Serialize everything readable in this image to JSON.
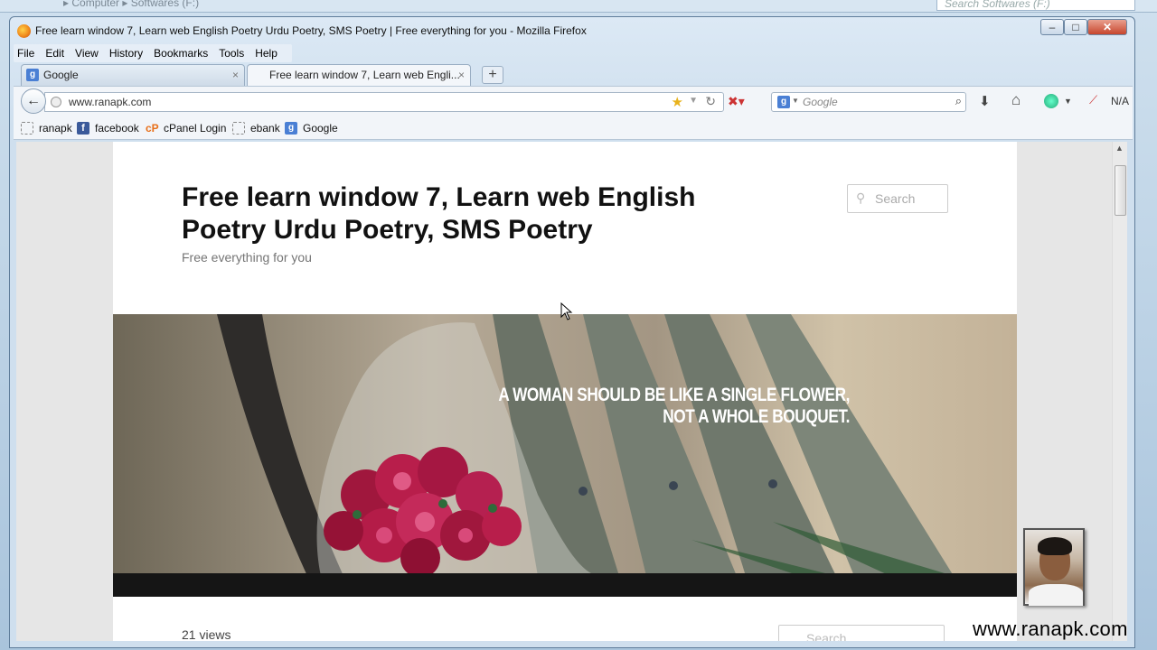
{
  "explorer": {
    "crumbs": "▸ Computer ▸ Softwares (F:)",
    "search_placeholder": "Search Softwares (F:)"
  },
  "window": {
    "title": "Free learn window 7, Learn web English Poetry Urdu Poetry, SMS Poetry | Free everything for you - Mozilla Firefox",
    "minimize": "–",
    "maximize": "□",
    "close": "✕"
  },
  "menubar": [
    "File",
    "Edit",
    "View",
    "History",
    "Bookmarks",
    "Tools",
    "Help"
  ],
  "tabs": [
    {
      "label": "Google",
      "close": "×"
    },
    {
      "label": "Free learn window 7, Learn web Engli...",
      "close": "×"
    }
  ],
  "newtab": "+",
  "nav": {
    "back": "←",
    "url": "www.ranapk.com",
    "star": "★",
    "dropdown": "▼",
    "reload": "↻",
    "search_engine": "Google",
    "search_go": "⌕",
    "download": "⬇",
    "home": "⌂",
    "addon_status": "N/A"
  },
  "bookmarks": [
    {
      "label": "ranapk",
      "icon": "page-icon"
    },
    {
      "label": "facebook",
      "icon": "facebook-icon",
      "glyph": "f"
    },
    {
      "label": "cPanel Login",
      "icon": "cpanel-icon",
      "glyph": "cP"
    },
    {
      "label": "ebank",
      "icon": "page-icon"
    },
    {
      "label": "Google",
      "icon": "google-icon",
      "glyph": "g"
    }
  ],
  "site": {
    "title": "Free learn window 7, Learn web English Poetry Urdu Poetry, SMS Poetry",
    "description": "Free everything for you",
    "search_placeholder": "Search",
    "hero_quote_line1": "A WOMAN SHOULD BE LIKE A SINGLE FLOWER,",
    "hero_quote_line2": "NOT A WHOLE BOUQUET.",
    "views": "21 views",
    "bottom_search_placeholder": "Search"
  },
  "overlay": {
    "watermark": "www.ranapk.com"
  },
  "colors": {
    "firefox_orange": "#f08a1c",
    "google_blue": "#4a7fd4",
    "facebook_blue": "#3b5a9a",
    "cpanel_orange": "#e8701a",
    "close_red": "#c7452d"
  }
}
